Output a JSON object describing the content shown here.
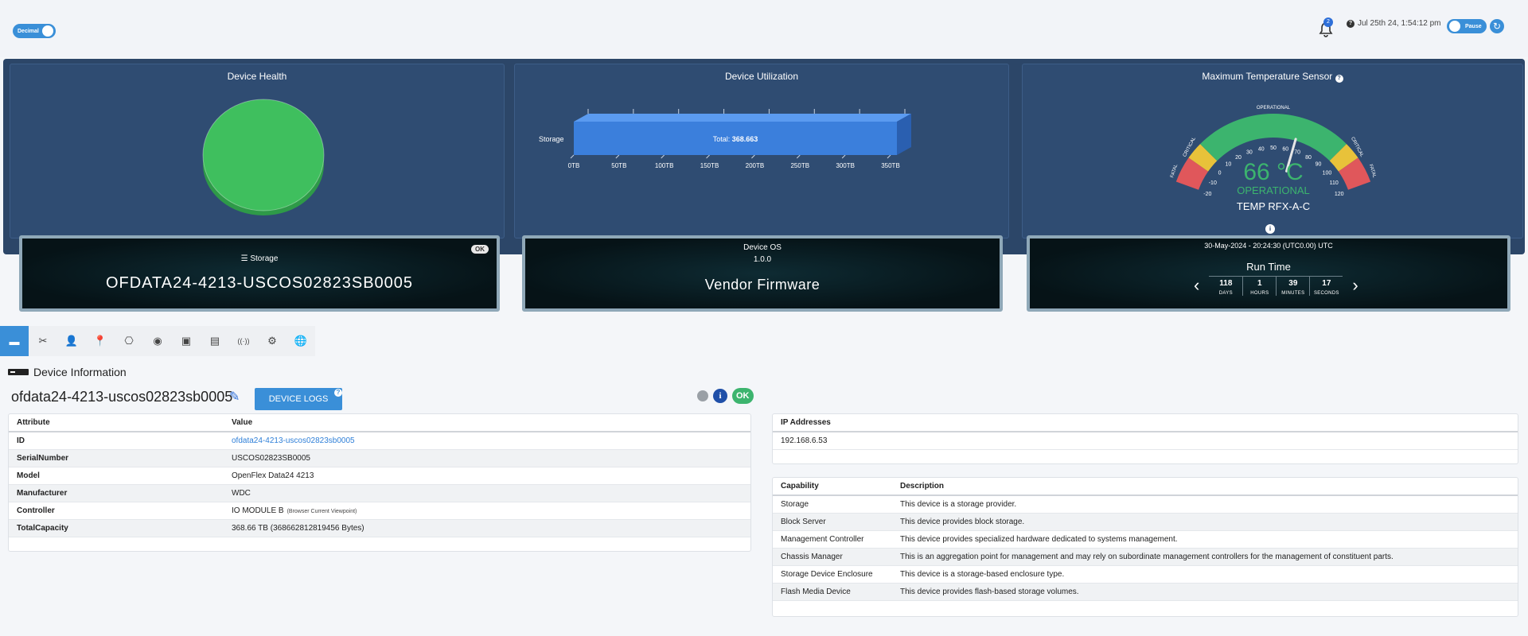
{
  "topbar": {
    "decimal_toggle": "Decimal",
    "notification_count": "2",
    "datetime": "Jul 25th 24, 1:54:12 pm",
    "pause_toggle": "Pause"
  },
  "health": {
    "title": "Device Health",
    "color": "#3fbf5e"
  },
  "utilization": {
    "title": "Device Utilization",
    "category": "Storage",
    "total_prefix": "Total:",
    "total_value": "368.663",
    "ticks": [
      "0TB",
      "50TB",
      "100TB",
      "150TB",
      "200TB",
      "250TB",
      "300TB",
      "350TB"
    ],
    "bar_color": "#3b7fdc"
  },
  "chart_data": {
    "type": "bar",
    "categories": [
      "Storage"
    ],
    "values": [
      368.663
    ],
    "xlim": [
      0,
      350
    ],
    "unit": "TB"
  },
  "temperature": {
    "title": "Maximum Temperature Sensor",
    "value": "66 °C",
    "status": "OPERATIONAL",
    "sensor": "TEMP RFX-A-C",
    "top_label": "OPERATIONAL",
    "left_labels": [
      "CRITICAL",
      "FATAL"
    ],
    "right_labels": [
      "CRITICAL",
      "FATAL"
    ],
    "scale": [
      "-20",
      "-10",
      "0",
      "10",
      "20",
      "30",
      "40",
      "50",
      "60",
      "70",
      "80",
      "90",
      "100",
      "110",
      "120"
    ],
    "reading": 66
  },
  "cards": {
    "storage_label": "Storage",
    "storage_ok": "OK",
    "device_name_upper": "OFDATA24-4213-USCOS02823SB0005",
    "os_label": "Device OS",
    "os_version": "1.0.0",
    "firmware": "Vendor Firmware",
    "runtime_date": "30-May-2024 - 20:24:30 (UTC0.00) UTC",
    "runtime_title": "Run Time",
    "runtime": [
      {
        "value": "118",
        "unit": "DAYS"
      },
      {
        "value": "1",
        "unit": "HOURS"
      },
      {
        "value": "39",
        "unit": "MINUTES"
      },
      {
        "value": "17",
        "unit": "SECONDS"
      }
    ]
  },
  "tabs": [
    "device-tab",
    "tools-tab",
    "user-tab",
    "location-tab",
    "network-tab",
    "drive-tab",
    "chip-tab",
    "port-tab",
    "wireless-tab",
    "settings-tab",
    "globe-tab"
  ],
  "device_info": {
    "section_title": "Device Information",
    "name": "ofdata24-4213-uscos02823sb0005",
    "logs_button": "DEVICE LOGS",
    "ok_badge": "OK",
    "columns": [
      "Attribute",
      "Value"
    ],
    "rows": [
      {
        "attr": "ID",
        "value": "ofdata24-4213-uscos02823sb0005",
        "link": true
      },
      {
        "attr": "SerialNumber",
        "value": "USCOS02823SB0005"
      },
      {
        "attr": "Model",
        "value": "OpenFlex Data24 4213"
      },
      {
        "attr": "Manufacturer",
        "value": "WDC"
      },
      {
        "attr": "Controller",
        "value": "IO MODULE B",
        "note": "(Browser Current Viewpoint)"
      },
      {
        "attr": "TotalCapacity",
        "value": "368.66 TB (368662812819456 Bytes)"
      }
    ]
  },
  "ip": {
    "header": "IP Addresses",
    "values": [
      "192.168.6.53"
    ]
  },
  "capabilities": {
    "columns": [
      "Capability",
      "Description"
    ],
    "rows": [
      {
        "name": "Storage",
        "desc": "This device is a storage provider."
      },
      {
        "name": "Block Server",
        "desc": "This device provides block storage."
      },
      {
        "name": "Management Controller",
        "desc": "This device provides specialized hardware dedicated to systems management."
      },
      {
        "name": "Chassis Manager",
        "desc": "This is an aggregation point for management and may rely on subordinate management controllers for the management of constituent parts."
      },
      {
        "name": "Storage Device Enclosure",
        "desc": "This device is a storage-based enclosure type."
      },
      {
        "name": "Flash Media Device",
        "desc": "This device provides flash-based storage volumes."
      }
    ]
  }
}
